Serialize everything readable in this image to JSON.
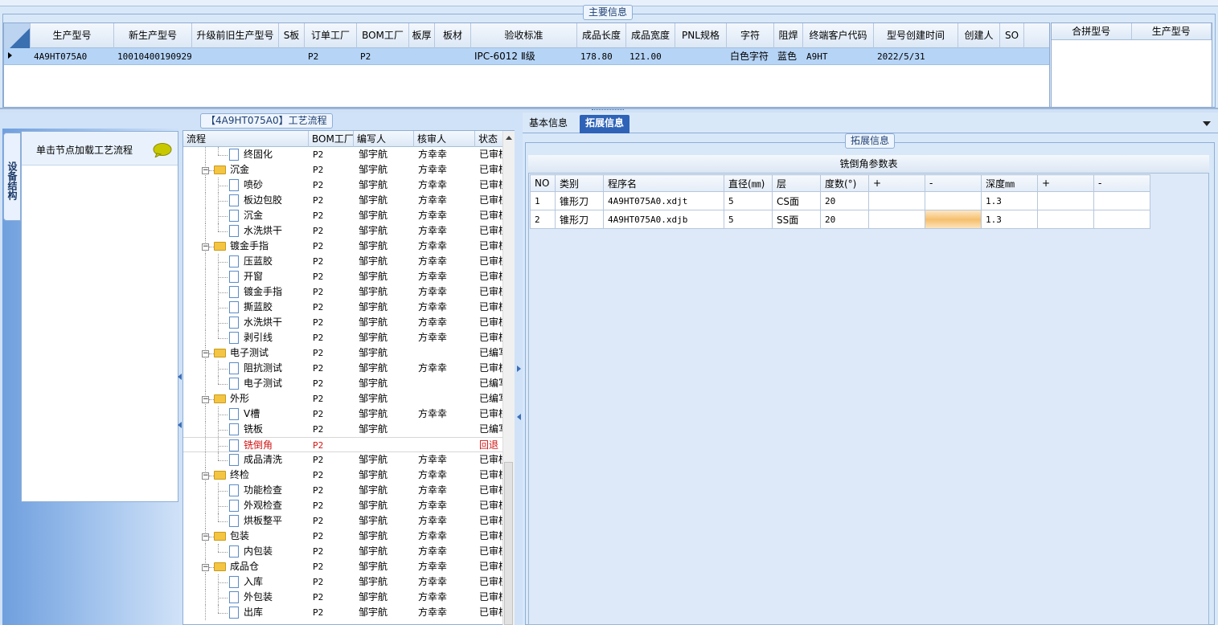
{
  "top": {
    "group_title": "主要信息",
    "columns": [
      "生产型号",
      "新生产型号",
      "升级前旧生产型号",
      "S板",
      "订单工厂",
      "BOM工厂",
      "板厚",
      "板材",
      "验收标准",
      "成品长度",
      "成品宽度",
      "PNL规格",
      "字符",
      "阻焊",
      "终端客户代码",
      "型号创建时间",
      "创建人",
      "SO"
    ],
    "row": [
      "4A9HT075A0",
      "10010400190929",
      "",
      "",
      "P2",
      "P2",
      "",
      "",
      "IPC-6012 Ⅱ级",
      "178.80",
      "121.00",
      "",
      "白色字符",
      "蓝色",
      "A9HT",
      "2022/5/31",
      "",
      ""
    ],
    "merge_columns": [
      "合拼型号",
      "生产型号"
    ]
  },
  "left": {
    "vertical_tab": "设备结构",
    "nav_label": "单击节点加载工艺流程",
    "flow_title": "【4A9HT075A0】工艺流程",
    "tree_columns": [
      "流程",
      "BOM工厂",
      "编写人",
      "核审人",
      "状态"
    ],
    "tree_rows": [
      {
        "level": 2,
        "type": "doc",
        "name": "终固化",
        "bom": "P2",
        "writer": "邹宇航",
        "reviewer": "方幸幸",
        "status": "已审核"
      },
      {
        "level": 1,
        "type": "folder",
        "name": "沉金",
        "bom": "P2",
        "writer": "邹宇航",
        "reviewer": "方幸幸",
        "status": "已审核"
      },
      {
        "level": 2,
        "type": "doc",
        "name": "喷砂",
        "bom": "P2",
        "writer": "邹宇航",
        "reviewer": "方幸幸",
        "status": "已审核"
      },
      {
        "level": 2,
        "type": "doc",
        "name": "板边包胶",
        "bom": "P2",
        "writer": "邹宇航",
        "reviewer": "方幸幸",
        "status": "已审核"
      },
      {
        "level": 2,
        "type": "doc",
        "name": "沉金",
        "bom": "P2",
        "writer": "邹宇航",
        "reviewer": "方幸幸",
        "status": "已审核"
      },
      {
        "level": 2,
        "type": "doc",
        "name": "水洗烘干",
        "bom": "P2",
        "writer": "邹宇航",
        "reviewer": "方幸幸",
        "status": "已审核"
      },
      {
        "level": 1,
        "type": "folder",
        "name": "镀金手指",
        "bom": "P2",
        "writer": "邹宇航",
        "reviewer": "方幸幸",
        "status": "已审核"
      },
      {
        "level": 2,
        "type": "doc",
        "name": "压蓝胶",
        "bom": "P2",
        "writer": "邹宇航",
        "reviewer": "方幸幸",
        "status": "已审核"
      },
      {
        "level": 2,
        "type": "doc",
        "name": "开窗",
        "bom": "P2",
        "writer": "邹宇航",
        "reviewer": "方幸幸",
        "status": "已审核"
      },
      {
        "level": 2,
        "type": "doc",
        "name": "镀金手指",
        "bom": "P2",
        "writer": "邹宇航",
        "reviewer": "方幸幸",
        "status": "已审核"
      },
      {
        "level": 2,
        "type": "doc",
        "name": "撕蓝胶",
        "bom": "P2",
        "writer": "邹宇航",
        "reviewer": "方幸幸",
        "status": "已审核"
      },
      {
        "level": 2,
        "type": "doc",
        "name": "水洗烘干",
        "bom": "P2",
        "writer": "邹宇航",
        "reviewer": "方幸幸",
        "status": "已审核"
      },
      {
        "level": 2,
        "type": "doc",
        "name": "剥引线",
        "bom": "P2",
        "writer": "邹宇航",
        "reviewer": "方幸幸",
        "status": "已审核"
      },
      {
        "level": 1,
        "type": "folder",
        "name": "电子测试",
        "bom": "P2",
        "writer": "邹宇航",
        "reviewer": "",
        "status": "已编写"
      },
      {
        "level": 2,
        "type": "doc",
        "name": "阻抗测试",
        "bom": "P2",
        "writer": "邹宇航",
        "reviewer": "方幸幸",
        "status": "已审核"
      },
      {
        "level": 2,
        "type": "doc",
        "name": "电子测试",
        "bom": "P2",
        "writer": "邹宇航",
        "reviewer": "",
        "status": "已编写"
      },
      {
        "level": 1,
        "type": "folder",
        "name": "外形",
        "bom": "P2",
        "writer": "邹宇航",
        "reviewer": "",
        "status": "已编写"
      },
      {
        "level": 2,
        "type": "doc",
        "name": "V槽",
        "bom": "P2",
        "writer": "邹宇航",
        "reviewer": "方幸幸",
        "status": "已审核"
      },
      {
        "level": 2,
        "type": "doc",
        "name": "铣板",
        "bom": "P2",
        "writer": "邹宇航",
        "reviewer": "",
        "status": "已编写"
      },
      {
        "level": 2,
        "type": "doc",
        "name": "铣倒角",
        "bom": "P2",
        "writer": "",
        "reviewer": "",
        "status": "回退",
        "selected": true
      },
      {
        "level": 2,
        "type": "doc",
        "name": "成品清洗",
        "bom": "P2",
        "writer": "邹宇航",
        "reviewer": "方幸幸",
        "status": "已审核"
      },
      {
        "level": 1,
        "type": "folder",
        "name": "终检",
        "bom": "P2",
        "writer": "邹宇航",
        "reviewer": "方幸幸",
        "status": "已审核"
      },
      {
        "level": 2,
        "type": "doc",
        "name": "功能检查",
        "bom": "P2",
        "writer": "邹宇航",
        "reviewer": "方幸幸",
        "status": "已审核"
      },
      {
        "level": 2,
        "type": "doc",
        "name": "外观检查",
        "bom": "P2",
        "writer": "邹宇航",
        "reviewer": "方幸幸",
        "status": "已审核"
      },
      {
        "level": 2,
        "type": "doc",
        "name": "烘板整平",
        "bom": "P2",
        "writer": "邹宇航",
        "reviewer": "方幸幸",
        "status": "已审核"
      },
      {
        "level": 1,
        "type": "folder",
        "name": "包装",
        "bom": "P2",
        "writer": "邹宇航",
        "reviewer": "方幸幸",
        "status": "已审核"
      },
      {
        "level": 2,
        "type": "doc",
        "name": "内包装",
        "bom": "P2",
        "writer": "邹宇航",
        "reviewer": "方幸幸",
        "status": "已审核"
      },
      {
        "level": 1,
        "type": "folder",
        "name": "成品仓",
        "bom": "P2",
        "writer": "邹宇航",
        "reviewer": "方幸幸",
        "status": "已审核"
      },
      {
        "level": 2,
        "type": "doc",
        "name": "入库",
        "bom": "P2",
        "writer": "邹宇航",
        "reviewer": "方幸幸",
        "status": "已审核"
      },
      {
        "level": 2,
        "type": "doc",
        "name": "外包装",
        "bom": "P2",
        "writer": "邹宇航",
        "reviewer": "方幸幸",
        "status": "已审核"
      },
      {
        "level": 2,
        "type": "doc",
        "name": "出库",
        "bom": "P2",
        "writer": "邹宇航",
        "reviewer": "方幸幸",
        "status": "已审核"
      }
    ]
  },
  "right": {
    "tabs": [
      "基本信息",
      "拓展信息"
    ],
    "active_tab": "拓展信息",
    "group_title": "拓展信息",
    "table_title": "铣倒角参数表",
    "table_columns": [
      "NO",
      "类别",
      "程序名",
      "直径(㎜)",
      "层",
      "度数(°)",
      "+",
      "-",
      "深度㎜",
      "+",
      "-"
    ],
    "table_rows": [
      [
        "1",
        "锥形刀",
        "4A9HT075A0.xdjt",
        "5",
        "CS面",
        "20",
        "",
        "",
        "1.3",
        "",
        ""
      ],
      [
        "2",
        "锥形刀",
        "4A9HT075A0.xdjb",
        "5",
        "SS面",
        "20",
        "",
        "",
        "1.3",
        "",
        ""
      ]
    ]
  },
  "colors": {
    "tab_active": "#2e63b8",
    "row_selected": "#b6d4f6",
    "returned_status": "#d21414",
    "highlight_cell": "#f5b35a"
  }
}
